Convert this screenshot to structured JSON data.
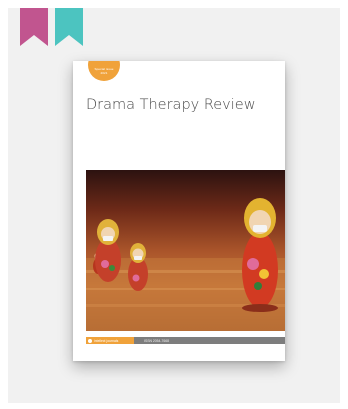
{
  "journal": {
    "title": "Drama Therapy Review",
    "badge_line1": "Special issue",
    "badge_line2": "2021",
    "publisher": "intellect journals",
    "issn": "ISSN 2054-7668"
  },
  "cover_image_alt": "Matryoshka dolls wearing face masks on a wooden table",
  "colors": {
    "bookmark_pink": "#c1558f",
    "bookmark_teal": "#4cc4c0",
    "badge_orange": "#f0a23a",
    "footer_grey": "#7d7d7d"
  },
  "icons": [
    "bookmark-pink-icon",
    "bookmark-teal-icon",
    "publisher-logo-icon"
  ]
}
